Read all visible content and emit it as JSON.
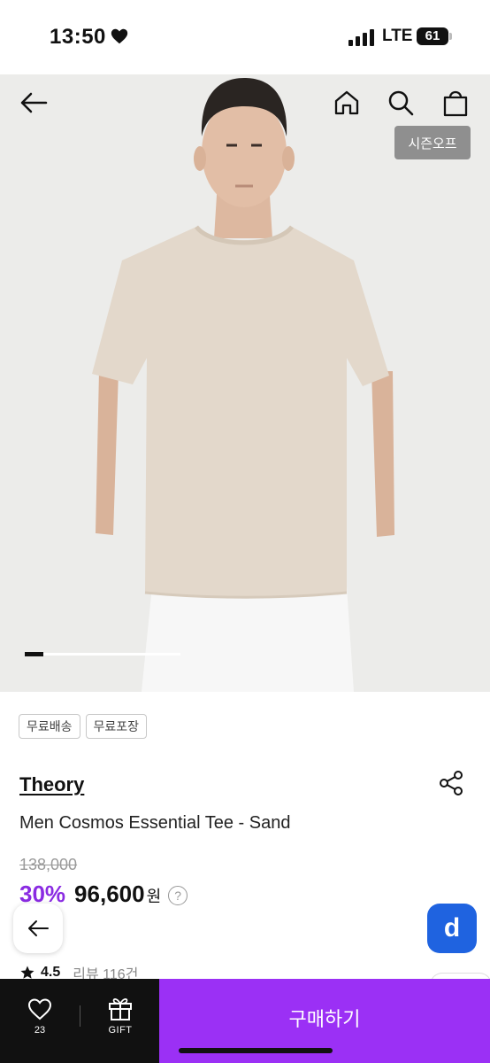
{
  "status_bar": {
    "time": "13:50",
    "network": "LTE",
    "battery": "61",
    "icons": [
      "heart-icon",
      "signal-icon",
      "battery-icon"
    ]
  },
  "hero": {
    "badge": "시즌오프",
    "icons": [
      "back-arrow-icon",
      "home-icon",
      "search-icon",
      "shopping-bag-icon"
    ],
    "slide_progress": 0.12
  },
  "tags": [
    "무료배송",
    "무료포장"
  ],
  "product": {
    "brand": "Theory",
    "name": "Men Cosmos Essential Tee - Sand",
    "original_price": "138,000",
    "discount": "30%",
    "price": "96,600",
    "currency": "원"
  },
  "rating": {
    "value": "4.5",
    "reviews": "리뷰 116건"
  },
  "floating": {
    "app_badge": "d"
  },
  "bottom_bar": {
    "like_count": "23",
    "gift_label": "GIFT",
    "buy_label": "구매하기"
  },
  "colors": {
    "accent_purple": "#9b30f5",
    "discount_purple": "#8a2be2",
    "app_badge_blue": "#1f63e0"
  }
}
